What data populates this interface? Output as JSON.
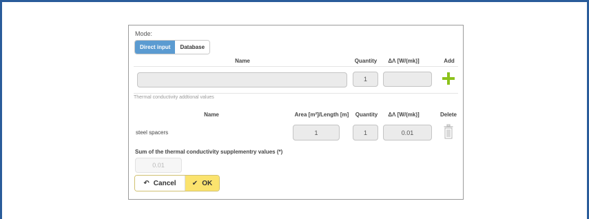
{
  "mode": {
    "label": "Mode:",
    "options": [
      "Direct input",
      "Database"
    ],
    "selected": "Direct input"
  },
  "input_table": {
    "headers": {
      "name": "Name",
      "quantity": "Quantity",
      "delta": "ΔΛ [W/(mk)]",
      "add": "Add"
    },
    "name_value": "",
    "quantity_value": "1",
    "delta_value": "",
    "add_icon": "plus-icon"
  },
  "additional": {
    "caption": "Thermal conductivity addtional values",
    "headers": {
      "name": "Name",
      "area": "Area [m²]/Length [m]",
      "quantity": "Quantity",
      "delta": "ΔΛ [W/(mk)]",
      "delete": "Delete"
    },
    "rows": [
      {
        "name": "steel spacers",
        "area": "1",
        "quantity": "1",
        "delta": "0.01"
      }
    ],
    "delete_icon": "trash-icon"
  },
  "sum": {
    "label": "Sum of the thermal conductivity supplementry values (*)",
    "value": "0.01"
  },
  "buttons": {
    "cancel": "Cancel",
    "ok": "OK",
    "cancel_icon": "undo-icon",
    "ok_icon": "check-icon"
  },
  "colors": {
    "frame": "#2a5c9a",
    "active_toggle": "#5b9bd1",
    "add": "#8cc21c",
    "ok_button": "#fbe36e"
  }
}
